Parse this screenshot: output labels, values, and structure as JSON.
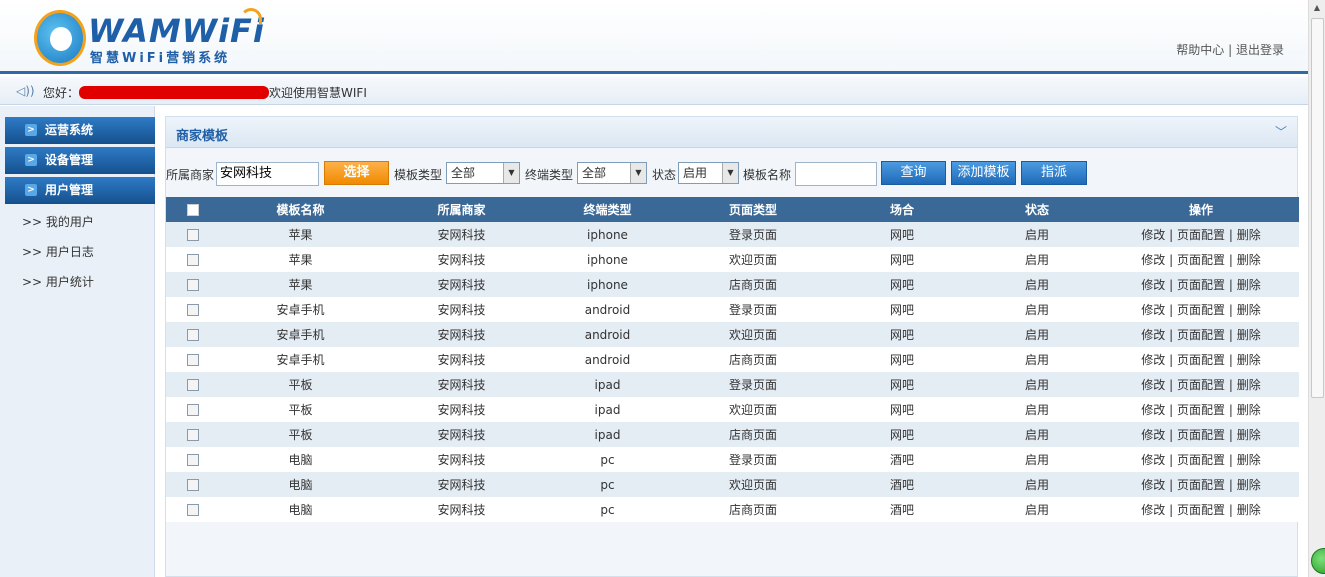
{
  "header": {
    "logo_text": "WAMWiFi",
    "logo_subtitle": "智慧WiFi营销系统",
    "help_link": "帮助中心",
    "separator": "|",
    "logout_link": "退出登录"
  },
  "welcome": {
    "greeting": "您好：",
    "message": "欢迎使用智慧WIFI"
  },
  "sidebar": {
    "groups": [
      {
        "label": "运营系统"
      },
      {
        "label": "设备管理"
      },
      {
        "label": "用户管理"
      }
    ],
    "items": [
      {
        "label": ">> 我的用户"
      },
      {
        "label": ">> 用户日志"
      },
      {
        "label": ">> 用户统计"
      }
    ]
  },
  "panel": {
    "title": "商家模板",
    "filters": {
      "merchant_label": "所属商家",
      "merchant_value": "安网科技",
      "select_button": "选择",
      "template_type_label": "模板类型",
      "template_type_value": "全部",
      "terminal_type_label": "终端类型",
      "terminal_type_value": "全部",
      "status_label": "状态",
      "status_value": "启用",
      "template_name_label": "模板名称",
      "template_name_value": "",
      "query_button": "查询",
      "add_button": "添加模板",
      "assign_button": "指派"
    },
    "table": {
      "headers": [
        "模板名称",
        "所属商家",
        "终端类型",
        "页面类型",
        "场合",
        "状态",
        "操作"
      ],
      "ops": {
        "edit": "修改",
        "config": "页面配置",
        "delete": "删除",
        "sep": "|"
      },
      "rows": [
        {
          "name": "苹果",
          "merchant": "安网科技",
          "terminal": "iphone",
          "page": "登录页面",
          "venue": "网吧",
          "status": "启用"
        },
        {
          "name": "苹果",
          "merchant": "安网科技",
          "terminal": "iphone",
          "page": "欢迎页面",
          "venue": "网吧",
          "status": "启用"
        },
        {
          "name": "苹果",
          "merchant": "安网科技",
          "terminal": "iphone",
          "page": "店商页面",
          "venue": "网吧",
          "status": "启用"
        },
        {
          "name": "安卓手机",
          "merchant": "安网科技",
          "terminal": "android",
          "page": "登录页面",
          "venue": "网吧",
          "status": "启用"
        },
        {
          "name": "安卓手机",
          "merchant": "安网科技",
          "terminal": "android",
          "page": "欢迎页面",
          "venue": "网吧",
          "status": "启用"
        },
        {
          "name": "安卓手机",
          "merchant": "安网科技",
          "terminal": "android",
          "page": "店商页面",
          "venue": "网吧",
          "status": "启用"
        },
        {
          "name": "平板",
          "merchant": "安网科技",
          "terminal": "ipad",
          "page": "登录页面",
          "venue": "网吧",
          "status": "启用"
        },
        {
          "name": "平板",
          "merchant": "安网科技",
          "terminal": "ipad",
          "page": "欢迎页面",
          "venue": "网吧",
          "status": "启用"
        },
        {
          "name": "平板",
          "merchant": "安网科技",
          "terminal": "ipad",
          "page": "店商页面",
          "venue": "网吧",
          "status": "启用"
        },
        {
          "name": "电脑",
          "merchant": "安网科技",
          "terminal": "pc",
          "page": "登录页面",
          "venue": "酒吧",
          "status": "启用"
        },
        {
          "name": "电脑",
          "merchant": "安网科技",
          "terminal": "pc",
          "page": "欢迎页面",
          "venue": "酒吧",
          "status": "启用"
        },
        {
          "name": "电脑",
          "merchant": "安网科技",
          "terminal": "pc",
          "page": "店商页面",
          "venue": "酒吧",
          "status": "启用"
        }
      ]
    }
  },
  "colors": {
    "brand_blue": "#1e5fa8",
    "header_row": "#3a6998",
    "status_red": "#d00000",
    "accent_orange": "#f08a00"
  }
}
